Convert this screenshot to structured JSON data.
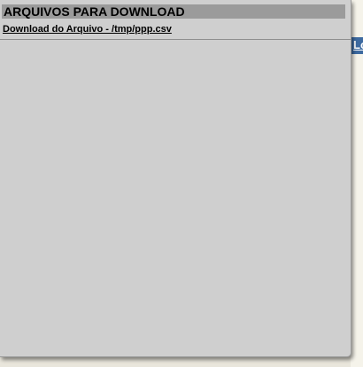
{
  "popup": {
    "title": "ARQUIVOS PARA DOWNLOAD",
    "download_link": "Download do Arquivo - /tmp/ppp.csv"
  },
  "background_page": {
    "partial_link_text": "Lo"
  },
  "colors": {
    "panel_background": "#cfcfcf",
    "header_background": "#9b9b9b",
    "background_link_bar": "#3d6aa0"
  }
}
